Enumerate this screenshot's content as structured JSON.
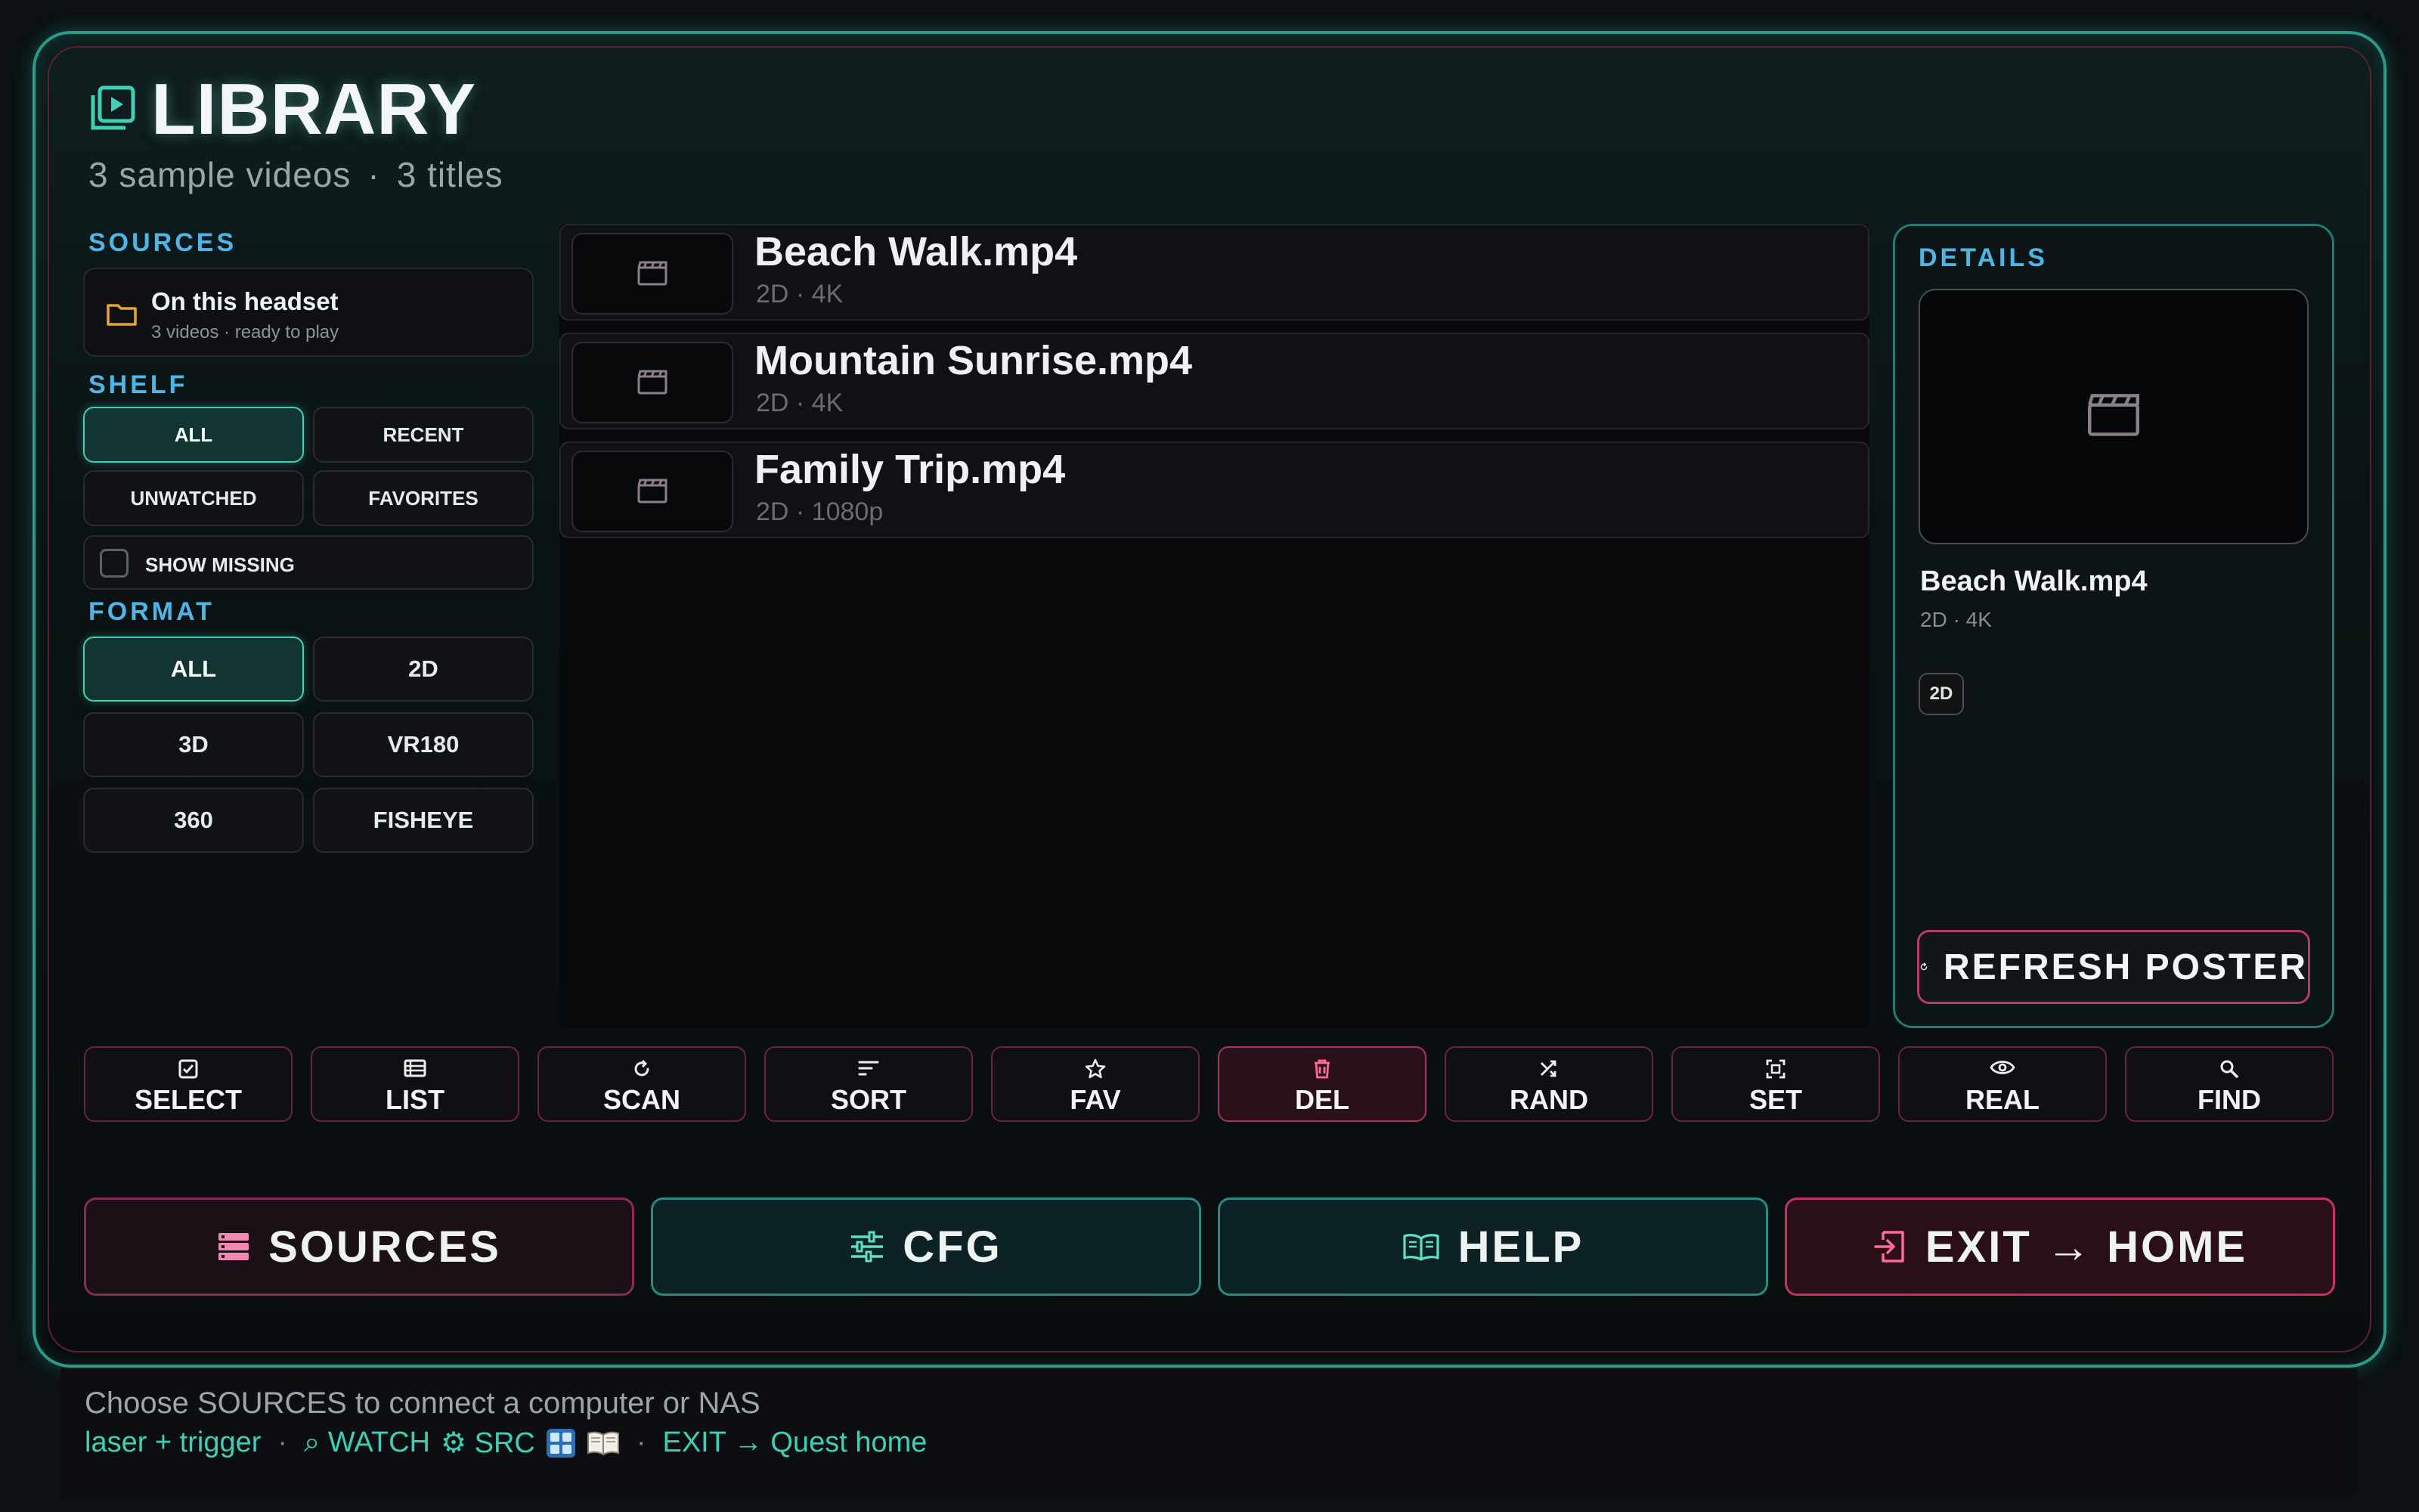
{
  "header": {
    "title": "LIBRARY",
    "subtitle_videos": "3 sample videos",
    "subtitle_sep": "·",
    "subtitle_titles": "3 titles"
  },
  "sidebar": {
    "sources_label": "SOURCES",
    "source": {
      "name": "On this headset",
      "meta": "3 videos · ready to play"
    },
    "shelf_label": "SHELF",
    "shelf": [
      "ALL",
      "RECENT",
      "UNWATCHED",
      "FAVORITES"
    ],
    "show_missing": "SHOW MISSING",
    "format_label": "FORMAT",
    "formats": [
      "ALL",
      "2D",
      "3D",
      "VR180",
      "360",
      "FISHEYE"
    ]
  },
  "videos": [
    {
      "name": "Beach Walk.mp4",
      "meta": "2D · 4K"
    },
    {
      "name": "Mountain Sunrise.mp4",
      "meta": "2D · 4K"
    },
    {
      "name": "Family Trip.mp4",
      "meta": "2D · 1080p"
    }
  ],
  "details": {
    "label": "DETAILS",
    "name": "Beach Walk.mp4",
    "meta": "2D · 4K",
    "badge": "2D",
    "refresh_label": "REFRESH POSTER"
  },
  "toolbar": [
    "SELECT",
    "LIST",
    "SCAN",
    "SORT",
    "FAV",
    "DEL",
    "RAND",
    "SET",
    "REAL",
    "FIND"
  ],
  "nav": {
    "sources": "SOURCES",
    "cfg": "CFG",
    "help": "HELP",
    "exit": "EXIT → HOME"
  },
  "footer": {
    "hint": "Choose SOURCES to connect a computer or NAS",
    "laser": "laser + trigger",
    "sep": "·",
    "watch": "⌕ WATCH",
    "src": "⚙ SRC",
    "exit": "EXIT → Quest home"
  },
  "colors": {
    "accent_teal": "#3fd0b4",
    "accent_pink": "#b73a6a",
    "section_blue": "#4fb5e6"
  }
}
